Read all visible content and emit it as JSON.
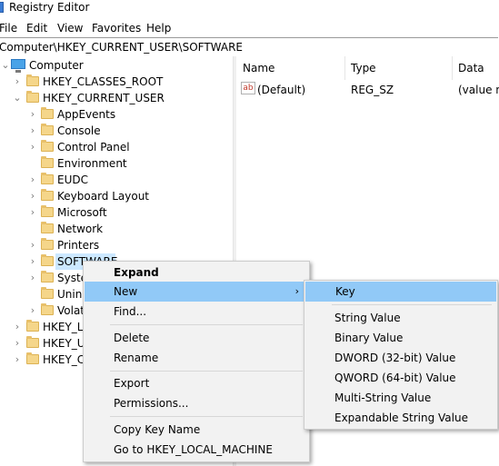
{
  "window": {
    "title": "Registry Editor"
  },
  "menubar": [
    "File",
    "Edit",
    "View",
    "Favorites",
    "Help"
  ],
  "address": "Computer\\HKEY_CURRENT_USER\\SOFTWARE",
  "tree": {
    "root": "Computer",
    "hkcr": "HKEY_CLASSES_ROOT",
    "hkcu": "HKEY_CURRENT_USER",
    "hkcu_children": [
      "AppEvents",
      "Console",
      "Control Panel",
      "Environment",
      "EUDC",
      "Keyboard Layout",
      "Microsoft",
      "Network",
      "Printers",
      "SOFTWARE",
      "System",
      "Uninstall",
      "Volatile Environment"
    ],
    "hkcu_children_visible": [
      "AppEvents",
      "Console",
      "Control Panel",
      "Environment",
      "EUDC",
      "Keyboard Layout",
      "Microsoft",
      "Network",
      "Printers",
      "SOFTWARE",
      "Syste",
      "Unins",
      "Volat"
    ],
    "bottom_visible": [
      "HKEY_LC",
      "HKEY_U",
      "HKEY_C"
    ]
  },
  "list": {
    "columns": [
      "Name",
      "Type",
      "Data"
    ],
    "rows": [
      {
        "name": "(Default)",
        "type": "REG_SZ",
        "data": "(value no"
      }
    ]
  },
  "context_menu": {
    "items": [
      "Expand",
      "New",
      "Find...",
      "Delete",
      "Rename",
      "Export",
      "Permissions...",
      "Copy Key Name",
      "Go to HKEY_LOCAL_MACHINE"
    ],
    "highlighted": "New"
  },
  "submenu": {
    "items": [
      "Key",
      "String Value",
      "Binary Value",
      "DWORD (32-bit) Value",
      "QWORD (64-bit) Value",
      "Multi-String Value",
      "Expandable String Value"
    ],
    "highlighted": "Key"
  },
  "colors": {
    "highlight": "#91c9f7",
    "selection": "#cce8ff",
    "menu_bg": "#f2f2f2"
  }
}
